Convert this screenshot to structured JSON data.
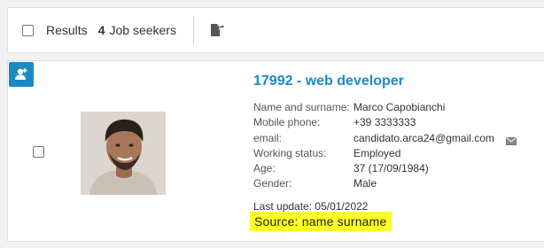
{
  "toolbar": {
    "results_label": "Results",
    "results_count": "4",
    "results_unit": "Job seekers",
    "export_icon": "export-icon"
  },
  "candidate": {
    "badge_icon": "add-user-icon",
    "title": "17992 - web developer",
    "fields": [
      {
        "label": "Name and surname:",
        "value": "Marco Capobianchi"
      },
      {
        "label": "Mobile phone:",
        "value": "+39 3333333"
      },
      {
        "label": "email:",
        "value": "candidato.arca24@gmail.com"
      },
      {
        "label": "Working status:",
        "value": "Employed"
      },
      {
        "label": "Age:",
        "value": "37 (17/09/1984)"
      },
      {
        "label": "Gender:",
        "value": "Male"
      }
    ],
    "last_update_label": "Last update:",
    "last_update_value": "05/01/2022",
    "source": "Source: name surname",
    "source_highlight_color": "#ffff28",
    "accent_color": "#1b8ac4"
  }
}
